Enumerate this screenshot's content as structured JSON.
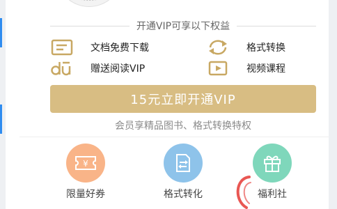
{
  "vip_header": {
    "text": "开通VIP可享以下权益"
  },
  "benefits": [
    {
      "icon": "document-icon",
      "label": "文档免费下载"
    },
    {
      "icon": "convert-icon",
      "label": "格式转换"
    },
    {
      "icon": "du-logo-icon",
      "label": "赠送阅读VIP"
    },
    {
      "icon": "video-play-icon",
      "label": "视频课程"
    }
  ],
  "cta": {
    "label": "15元立即开通VIP"
  },
  "cta_sub": {
    "text": "会员享精品图书、格式转换特权"
  },
  "quick_actions": [
    {
      "icon": "coupon-icon",
      "label": "限量好券",
      "color": "#f9b488"
    },
    {
      "icon": "format-convert-icon",
      "label": "格式转化",
      "color": "#8ec3ea"
    },
    {
      "icon": "gift-icon",
      "label": "福利社",
      "color": "#7fd7bb"
    }
  ],
  "colors": {
    "accent_gold": "#d8bd83",
    "icon_gold": "#c8a863",
    "left_accent": "#2f8cf0"
  }
}
